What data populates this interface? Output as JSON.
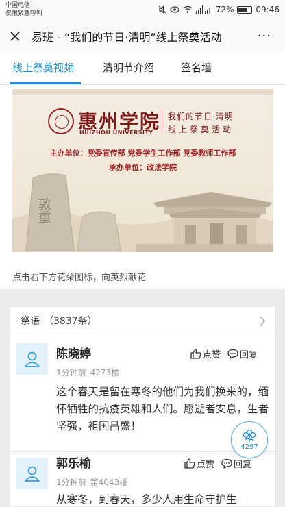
{
  "status_bar": {
    "carrier": "中国电信",
    "carrier_note": "仅限紧急呼叫",
    "battery": "72%",
    "time": "09:46"
  },
  "header": {
    "title": "易班 - “我们的节日·清明”线上祭奠活动",
    "close_icon": "close-icon",
    "more_label": "···"
  },
  "tabs": [
    {
      "label": "线上祭奠视频",
      "active": true
    },
    {
      "label": "清明节介绍",
      "active": false
    },
    {
      "label": "签名墙",
      "active": false
    }
  ],
  "banner": {
    "university_cn": "惠州学院",
    "university_en": "HUIZHOU UNIVERSITY",
    "event_line1": "我们的节日·清明",
    "event_line2": "线上祭奠活动",
    "sponsor": "主办单位：党委宣传部  党委学生工作部  党委教师工作部",
    "organizer": "承办单位：政法学院",
    "rock_text": "敦重"
  },
  "caption": "点击右下方花朵图标，向英烈献花",
  "messages": {
    "title": "祭语",
    "count": "（3837条）",
    "like_label": "点赞",
    "reply_label": "回复",
    "items": [
      {
        "name": "陈晓婷",
        "time": "1分钟前",
        "floor": "4273楼",
        "text": "这个春天是留在寒冬的他们为我们换来的，缅怀牺牲的抗疫英雄和人们。愿逝者安息，生者坚强，祖国昌盛！"
      },
      {
        "name": "郭乐榆",
        "time": "1分钟前",
        "floor": "第4043楼",
        "text": "从寒冬，到春天，多少人用生命守护生"
      }
    ]
  },
  "flower_button": {
    "count": "4297"
  },
  "colors": {
    "accent": "#1a8fd8",
    "banner_red": "#7a1c1c"
  }
}
